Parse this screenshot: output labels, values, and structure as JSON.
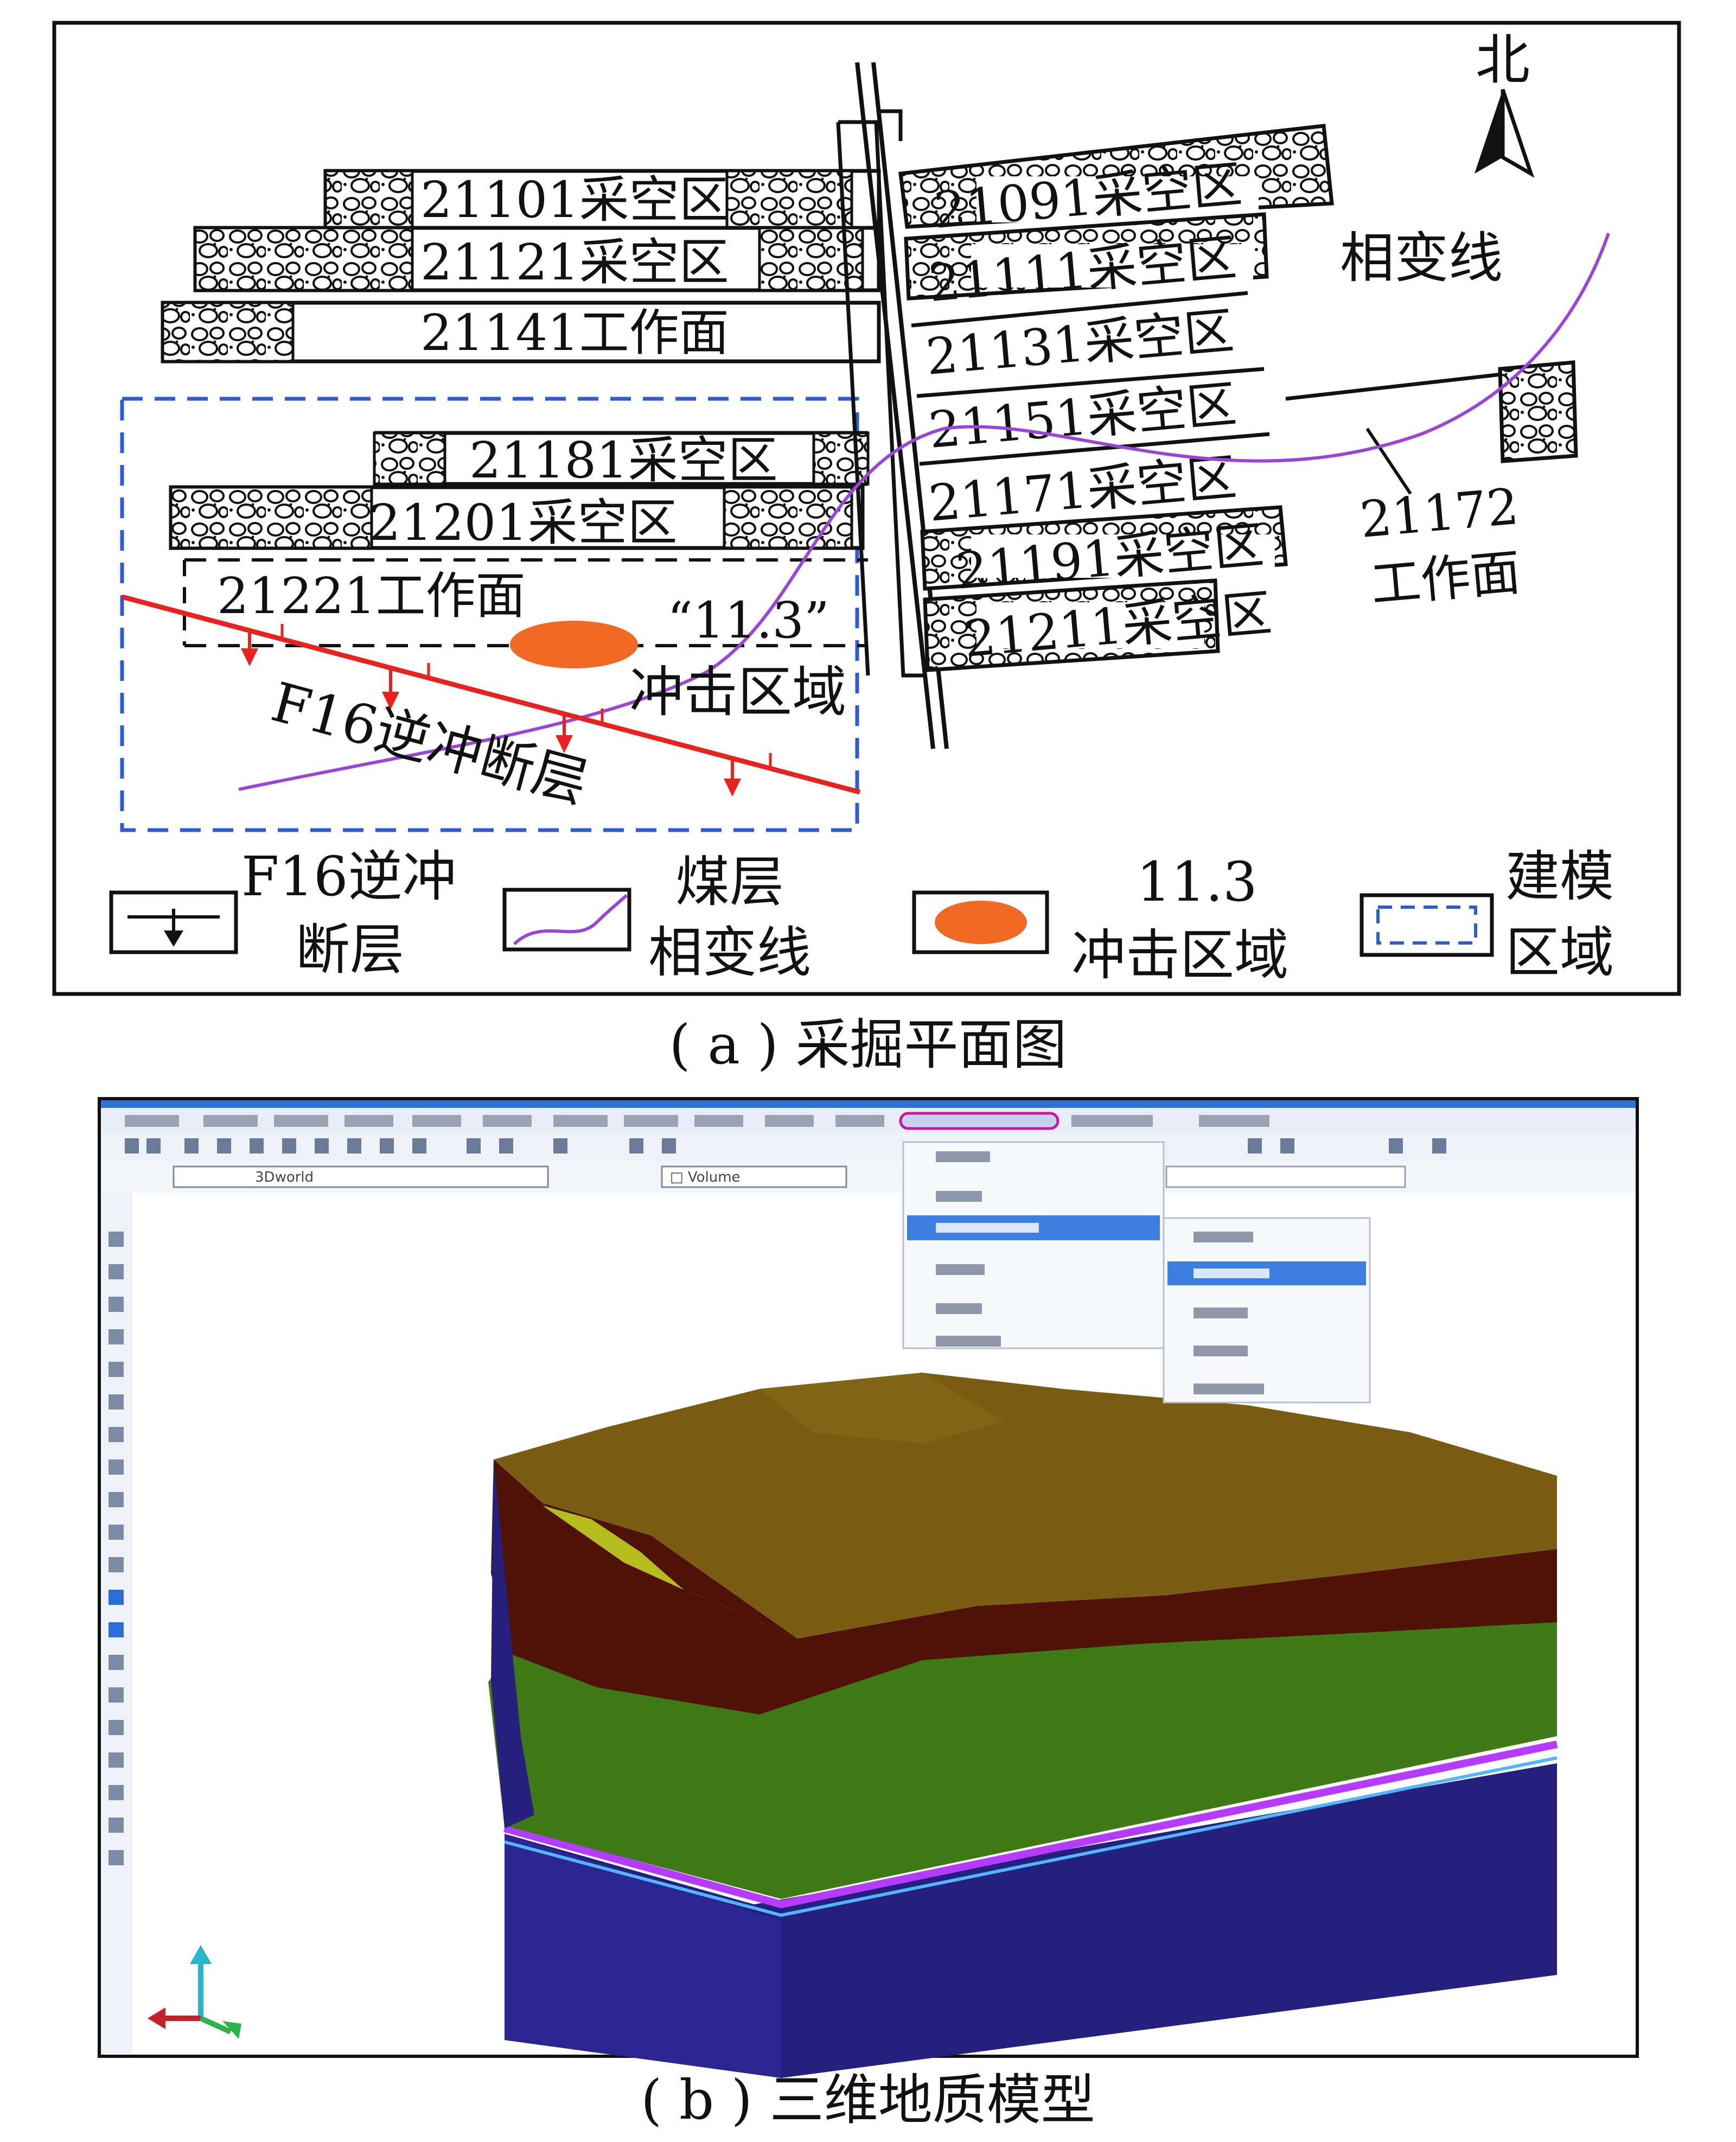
{
  "panel_a": {
    "caption": "( a ) 采掘平面图",
    "north": "北",
    "west_panels": [
      {
        "label": "21101采空区"
      },
      {
        "label": "21121采空区"
      },
      {
        "label": "21141工作面"
      },
      {
        "label": "21181采空区"
      },
      {
        "label": "21201采空区"
      },
      {
        "label": "21221工作面"
      }
    ],
    "east_panels": [
      {
        "label": "21091采空区"
      },
      {
        "label": "21111采空区"
      },
      {
        "label": "21131采空区"
      },
      {
        "label": "21151采空区"
      },
      {
        "label": "21171采空区"
      },
      {
        "label": "21191采空区"
      },
      {
        "label": "21211采空区"
      }
    ],
    "phase_line_label": "相变线",
    "face_21172": {
      "line1": "21172",
      "line2": "工作面"
    },
    "impact_label": {
      "line1": "“11.3”",
      "line2": "冲击区域"
    },
    "fault_label": "F16逆冲断层",
    "legend": [
      {
        "line1": "F16逆冲",
        "line2": "断层"
      },
      {
        "line1": "煤层",
        "line2": "相变线"
      },
      {
        "line1": "11.3",
        "line2": "冲击区域"
      },
      {
        "line1": "建模",
        "line2": "区域"
      }
    ],
    "colors": {
      "fault": "#e8231f",
      "phase_line": "#9b45d6",
      "impact": "#f06a25",
      "model_region": "#2e5bd6"
    }
  },
  "panel_b": {
    "caption": "( b ) 三维地质模型",
    "toolbar_field_1": "3Dworld",
    "toolbar_field_2": "□ Volume",
    "layer_colors": {
      "top": "#7a5c12",
      "maroon": "#4e1208",
      "green": "#3f7a17",
      "purple": "#b43bff",
      "blue": "#25207e"
    }
  }
}
